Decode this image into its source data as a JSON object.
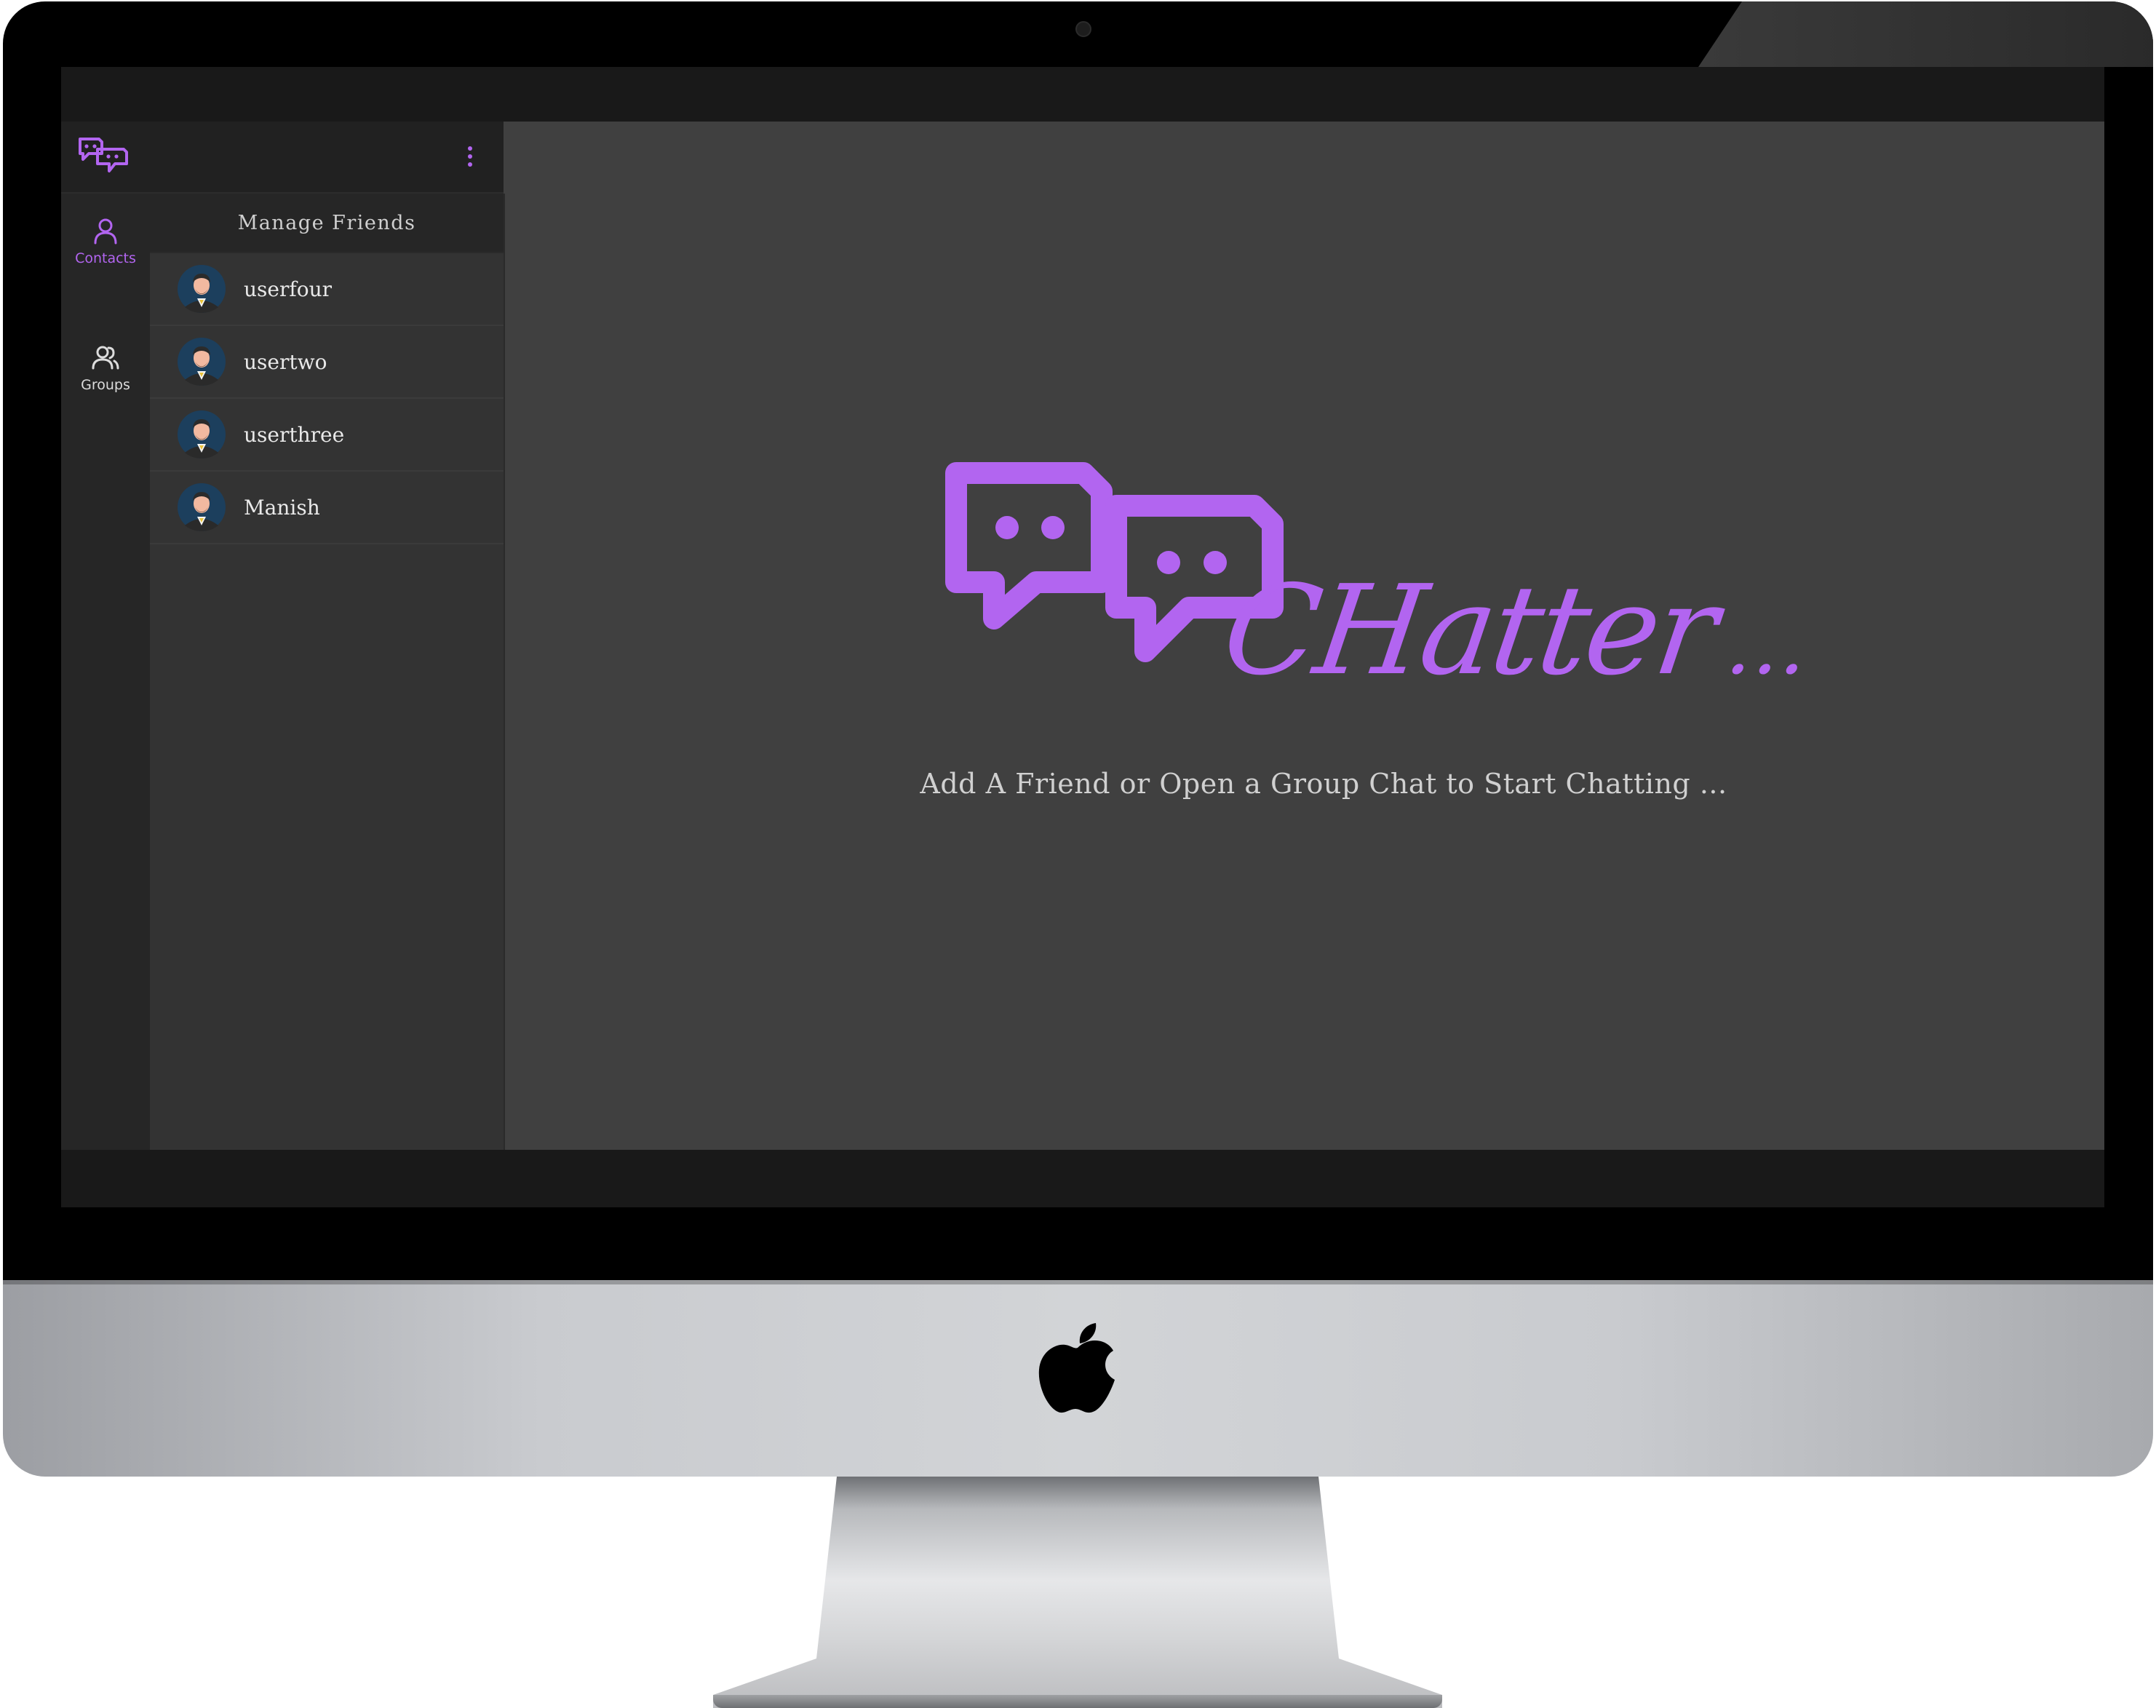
{
  "app": {
    "brand": "CHatter",
    "brand_dots": "...",
    "accent_color": "#b265f0"
  },
  "header": {
    "logo_icon": "chat-bubbles-icon",
    "menu_icon": "kebab-menu-icon"
  },
  "rail": {
    "items": [
      {
        "label": "Contacts",
        "icon": "user-icon",
        "active": true
      },
      {
        "label": "Groups",
        "icon": "users-icon",
        "active": false
      }
    ]
  },
  "friends_panel": {
    "title": "Manage Friends",
    "friends": [
      {
        "name": "userfour",
        "avatar": "avatar-icon"
      },
      {
        "name": "usertwo",
        "avatar": "avatar-icon"
      },
      {
        "name": "userthree",
        "avatar": "avatar-icon"
      },
      {
        "name": "Manish",
        "avatar": "avatar-icon"
      }
    ]
  },
  "welcome": {
    "message": "Add A Friend or Open a Group Chat to Start Chatting ..."
  }
}
